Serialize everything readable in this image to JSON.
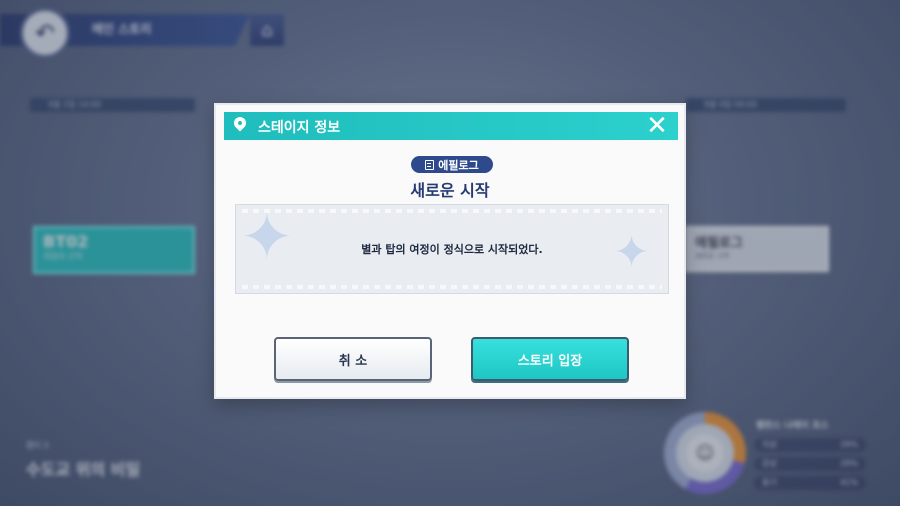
{
  "background": {
    "top_title": "메인 스토리",
    "timebars": [
      "9월 2일 14:00",
      "9월 9일 09:00"
    ],
    "stage_left": {
      "code": "BT02",
      "sub": "계절의 선택"
    },
    "stage_right": {
      "code": "에필로그",
      "sub": "새로운 시작"
    },
    "chapter_tag": "챕터 3",
    "chapter_title": "수도교 위의 비밀",
    "gauge": {
      "title": "밸런스 나레이 포스",
      "rows": [
        {
          "label": "지성",
          "value": "29%",
          "color": "#f39a3d"
        },
        {
          "label": "감성",
          "value": "29%",
          "color": "#7e6fd6"
        },
        {
          "label": "용기",
          "value": "41%",
          "color": "#a6b4d8"
        }
      ]
    }
  },
  "modal": {
    "header_title": "스테이지 정보",
    "badge_label": "에필로그",
    "stage_title": "새로운 시작",
    "description": "별과 탑의 여정이 정식으로 시작되었다.",
    "cancel_label": "취 소",
    "enter_label": "스토리 입장",
    "accent_color": "#1fbdbd",
    "title_color": "#273b73"
  }
}
